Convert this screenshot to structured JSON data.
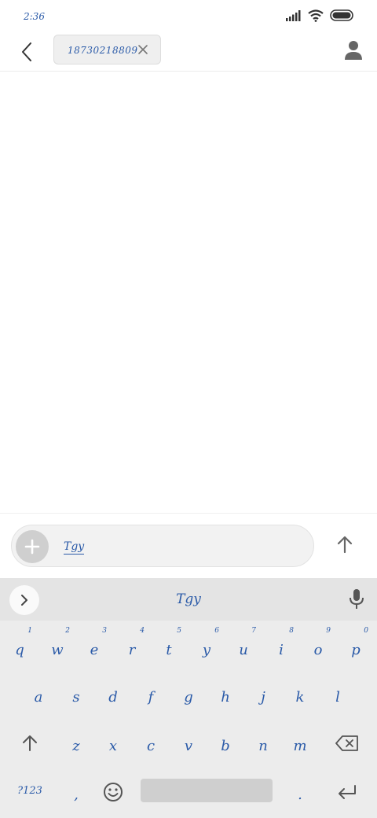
{
  "status_bar": {
    "time": "2:36",
    "icons": [
      "signal-icon",
      "wifi-icon",
      "battery-icon"
    ]
  },
  "header": {
    "back_icon": "back-arrow-icon",
    "recipient": "18730218809",
    "chip_close_icon": "close-icon",
    "contact_icon": "person-icon"
  },
  "compose": {
    "attach_icon": "plus-icon",
    "text": "Tgy",
    "send_icon": "arrow-up-icon"
  },
  "keyboard": {
    "suggestion": "Tgy",
    "row1": [
      {
        "key": "q",
        "hint": "1"
      },
      {
        "key": "w",
        "hint": "2"
      },
      {
        "key": "e",
        "hint": "3"
      },
      {
        "key": "r",
        "hint": "4"
      },
      {
        "key": "t",
        "hint": "5"
      },
      {
        "key": "y",
        "hint": "6"
      },
      {
        "key": "u",
        "hint": "7"
      },
      {
        "key": "i",
        "hint": "8"
      },
      {
        "key": "o",
        "hint": "9"
      },
      {
        "key": "p",
        "hint": "0"
      }
    ],
    "row2": [
      "a",
      "s",
      "d",
      "f",
      "g",
      "h",
      "j",
      "k",
      "l"
    ],
    "row3": [
      "z",
      "x",
      "c",
      "v",
      "b",
      "n",
      "m"
    ],
    "symbols_label": "?123",
    "comma": ",",
    "period": "."
  },
  "colors": {
    "text_accent": "#2a5aa8",
    "keyboard_bg": "#ececec",
    "chip_bg": "#efefef"
  }
}
